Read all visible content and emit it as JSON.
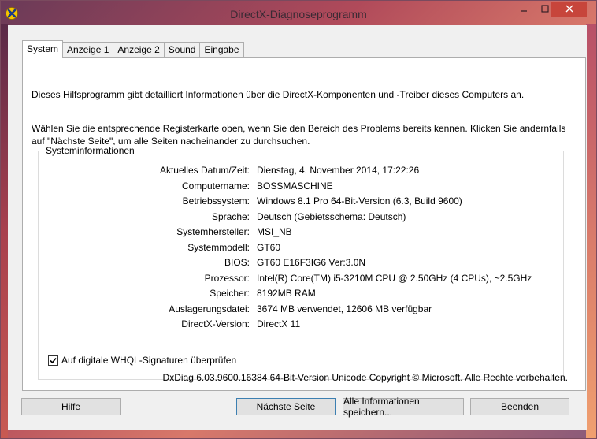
{
  "window": {
    "title": "DirectX-Diagnoseprogramm",
    "icon": "directx-icon",
    "minimize_icon": "minimize-icon",
    "maximize_icon": "maximize-icon",
    "close_icon": "close-icon",
    "close_color": "#c7453b"
  },
  "tabs": [
    {
      "label": "System",
      "active": true
    },
    {
      "label": "Anzeige 1",
      "active": false
    },
    {
      "label": "Anzeige 2",
      "active": false
    },
    {
      "label": "Sound",
      "active": false
    },
    {
      "label": "Eingabe",
      "active": false
    }
  ],
  "panel": {
    "intro1": "Dieses Hilfsprogramm gibt detailliert Informationen über die DirectX-Komponenten und -Treiber dieses Computers an.",
    "intro2": "Wählen Sie die entsprechende Registerkarte oben, wenn Sie den Bereich des Problems bereits kennen. Klicken Sie andernfalls auf \"Nächste Seite\", um alle Seiten nacheinander zu durchsuchen.",
    "group_title": "Systeminformationen",
    "rows": [
      {
        "label": "Aktuelles Datum/Zeit:",
        "value": "Dienstag, 4. November 2014, 17:22:26"
      },
      {
        "label": "Computername:",
        "value": "BOSSMASCHINE"
      },
      {
        "label": "Betriebssystem:",
        "value": "Windows 8.1 Pro 64-Bit-Version (6.3, Build 9600)"
      },
      {
        "label": "Sprache:",
        "value": "Deutsch (Gebietsschema: Deutsch)"
      },
      {
        "label": "Systemhersteller:",
        "value": "MSI_NB"
      },
      {
        "label": "Systemmodell:",
        "value": "GT60"
      },
      {
        "label": "BIOS:",
        "value": "GT60 E16F3IG6 Ver:3.0N"
      },
      {
        "label": "Prozessor:",
        "value": "Intel(R) Core(TM) i5-3210M CPU @ 2.50GHz (4 CPUs), ~2.5GHz"
      },
      {
        "label": "Speicher:",
        "value": "8192MB RAM"
      },
      {
        "label": "Auslagerungsdatei:",
        "value": "3674 MB verwendet, 12606 MB verfügbar"
      },
      {
        "label": "DirectX-Version:",
        "value": "DirectX 11"
      }
    ],
    "checkbox_label": "Auf digitale WHQL-Signaturen überprüfen",
    "checkbox_checked": true,
    "version_text": "DxDiag 6.03.9600.16384 64-Bit-Version Unicode Copyright © Microsoft. Alle Rechte vorbehalten."
  },
  "buttons": {
    "help": "Hilfe",
    "next": "Nächste Seite",
    "save_all": "Alle Informationen speichern...",
    "quit": "Beenden"
  }
}
